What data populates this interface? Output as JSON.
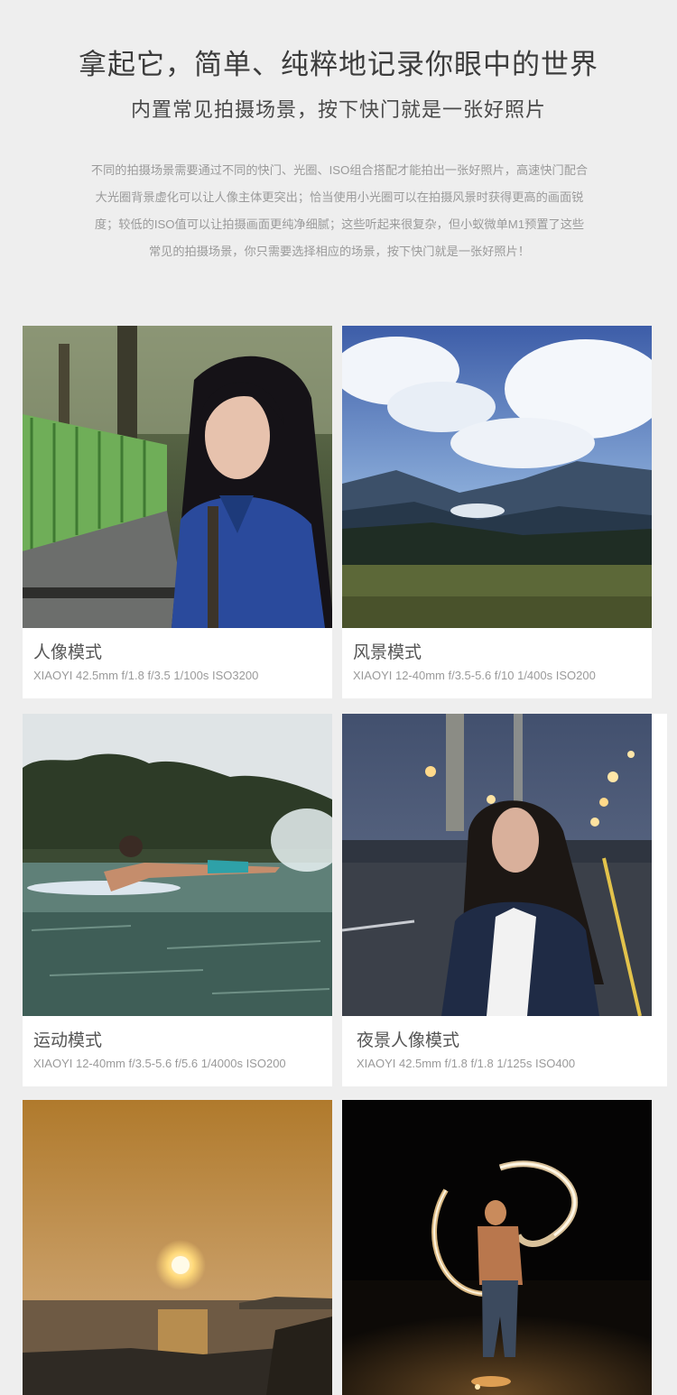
{
  "header": {
    "title": "拿起它，简单、纯粹地记录你眼中的世界",
    "subtitle": "内置常见拍摄场景，按下快门就是一张好照片",
    "description_lines": [
      "不同的拍摄场景需要通过不同的快门、光圈、ISO组合搭配才能拍出一张好照片，高速快门配合",
      "大光圈背景虚化可以让人像主体更突出；恰当使用小光圈可以在拍摄风景时获得更高的画面锐",
      "度；较低的ISO值可以让拍摄画面更纯净细腻；这些听起来很复杂，但小蚁微单M1预置了这些",
      "常见的拍摄场景，你只需要选择相应的场景，按下快门就是一张好照片！"
    ]
  },
  "modes": [
    {
      "name": "人像模式",
      "spec": "XIAOYI 42.5mm f/1.8   f/3.5  1/100s  ISO3200",
      "photo_icon": "portrait-photo"
    },
    {
      "name": "风景模式",
      "spec": "XIAOYI 12-40mm f/3.5-5.6   f/10  1/400s  ISO200",
      "photo_icon": "landscape-photo"
    },
    {
      "name": "运动模式",
      "spec": "XIAOYI 12-40mm f/3.5-5.6   f/5.6  1/4000s  ISO200",
      "photo_icon": "surfer-photo"
    },
    {
      "name": "夜景人像模式",
      "spec": "XIAOYI 42.5mm f/1.8   f/1.8  1/125s  ISO400",
      "photo_icon": "night-portrait-photo"
    },
    {
      "photo_icon": "sunset-photo"
    },
    {
      "photo_icon": "fire-spinner-photo"
    }
  ],
  "colors": {
    "background": "#eeeeee",
    "card": "#ffffff",
    "title_text": "#3c3c3c",
    "body_text": "#9a9a9a"
  }
}
